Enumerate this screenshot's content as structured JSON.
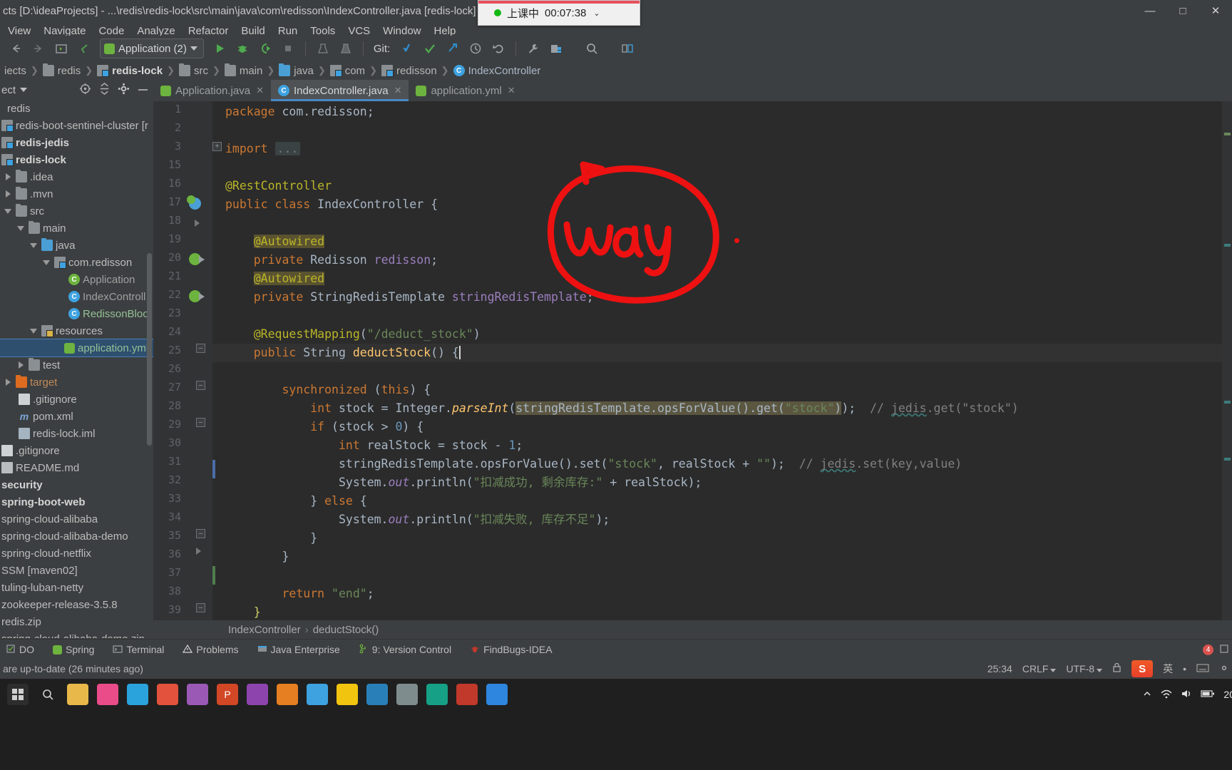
{
  "window": {
    "title": "cts [D:\\ideaProjects] - ...\\redis\\redis-lock\\src\\main\\java\\com\\redisson\\IndexController.java [redis-lock]",
    "minimize": "—",
    "maximize": "□",
    "close": "✕"
  },
  "timer_overlay": {
    "status_text": "上课中",
    "time": "00:07:38",
    "caret": "⌄"
  },
  "menubar": {
    "items": [
      "View",
      "Navigate",
      "Code",
      "Analyze",
      "Refactor",
      "Build",
      "Run",
      "Tools",
      "VCS",
      "Window",
      "Help"
    ]
  },
  "toolbar": {
    "back": "←",
    "forward": "→",
    "run_config_label": "Application (2)",
    "git_label": "Git:",
    "tooltips": {
      "run": "Run",
      "debug": "Debug",
      "run_coverage": "Run with Coverage",
      "stop": "Stop",
      "update_project": "Update Project",
      "commit": "Commit",
      "push": "Push",
      "history": "History",
      "rollback": "Rollback",
      "settings": "Settings",
      "project_structure": "Project Structure",
      "search": "Search Everywhere"
    }
  },
  "breadcrumb": {
    "items": [
      {
        "label": "iects",
        "icon": "folder-icon",
        "bold": false
      },
      {
        "label": "redis",
        "icon": "folder-icon",
        "bold": false
      },
      {
        "label": "redis-lock",
        "icon": "module-icon",
        "bold": true
      },
      {
        "label": "src",
        "icon": "folder-icon",
        "bold": false
      },
      {
        "label": "main",
        "icon": "folder-icon",
        "bold": false
      },
      {
        "label": "java",
        "icon": "source-folder-icon",
        "bold": false
      },
      {
        "label": "com",
        "icon": "package-icon",
        "bold": false
      },
      {
        "label": "redisson",
        "icon": "package-icon",
        "bold": false
      },
      {
        "label": "IndexController",
        "icon": "class-icon",
        "bold": false
      }
    ]
  },
  "project_panel": {
    "title": "ect",
    "caret": "▾",
    "icons": [
      "locate-icon",
      "collapse-all-icon",
      "gear-icon",
      "hide-icon"
    ],
    "tree": [
      {
        "label": "redis",
        "indent": 0,
        "icon": "none",
        "twisty": "none",
        "style": "plain"
      },
      {
        "label": "redis-boot-sentinel-cluster [r",
        "indent": 0,
        "icon": "module-icon",
        "twisty": "none",
        "style": "plain"
      },
      {
        "label": "redis-jedis",
        "indent": 0,
        "icon": "module-icon",
        "twisty": "none",
        "style": "bold"
      },
      {
        "label": "redis-lock",
        "indent": 0,
        "icon": "module-icon",
        "twisty": "none",
        "style": "bold"
      },
      {
        "label": ".idea",
        "indent": 1,
        "icon": "folder-icon",
        "twisty": "right",
        "style": "plain"
      },
      {
        "label": ".mvn",
        "indent": 1,
        "icon": "folder-icon",
        "twisty": "right",
        "style": "plain"
      },
      {
        "label": "src",
        "indent": 1,
        "icon": "folder-icon",
        "twisty": "down",
        "style": "plain"
      },
      {
        "label": "main",
        "indent": 2,
        "icon": "folder-icon",
        "twisty": "down",
        "style": "plain"
      },
      {
        "label": "java",
        "indent": 3,
        "icon": "source-folder-icon",
        "twisty": "down",
        "style": "plain"
      },
      {
        "label": "com.redisson",
        "indent": 4,
        "icon": "package-icon",
        "twisty": "down",
        "style": "plain"
      },
      {
        "label": "Application",
        "indent": 5,
        "icon": "spring-class-icon",
        "twisty": "none",
        "style": "plain"
      },
      {
        "label": "IndexControll",
        "indent": 5,
        "icon": "class-icon",
        "twisty": "none",
        "style": "plain"
      },
      {
        "label": "RedissonBloo",
        "indent": 5,
        "icon": "runnable-class-icon",
        "twisty": "none",
        "style": "green"
      },
      {
        "label": "resources",
        "indent": 3,
        "icon": "resource-folder-icon",
        "twisty": "down",
        "style": "plain"
      },
      {
        "label": "application.yml",
        "indent": 4,
        "icon": "spring-yaml-icon",
        "twisty": "none",
        "style": "selected"
      },
      {
        "label": "test",
        "indent": 2,
        "icon": "folder-icon",
        "twisty": "right",
        "style": "plain"
      },
      {
        "label": "target",
        "indent": 1,
        "icon": "excluded-folder-icon",
        "twisty": "right",
        "style": "plain"
      },
      {
        "label": ".gitignore",
        "indent": 2,
        "icon": "file-icon",
        "twisty": "none",
        "style": "plain"
      },
      {
        "label": "pom.xml",
        "indent": 2,
        "icon": "maven-icon",
        "twisty": "none",
        "style": "plain"
      },
      {
        "label": "redis-lock.iml",
        "indent": 2,
        "icon": "iml-icon",
        "twisty": "none",
        "style": "plain"
      },
      {
        "label": ".gitignore",
        "indent": 0,
        "icon": "file-icon",
        "twisty": "none",
        "style": "plain"
      },
      {
        "label": "README.md",
        "indent": 0,
        "icon": "markdown-icon",
        "twisty": "none",
        "style": "plain"
      },
      {
        "label": "security",
        "indent": 0,
        "icon": "none",
        "twisty": "none",
        "style": "bold"
      },
      {
        "label": "spring-boot-web",
        "indent": 0,
        "icon": "none",
        "twisty": "none",
        "style": "bold"
      },
      {
        "label": "spring-cloud-alibaba",
        "indent": 0,
        "icon": "none",
        "twisty": "none",
        "style": "plain"
      },
      {
        "label": "spring-cloud-alibaba-demo",
        "indent": 0,
        "icon": "none",
        "twisty": "none",
        "style": "plain"
      },
      {
        "label": "spring-cloud-netflix",
        "indent": 0,
        "icon": "none",
        "twisty": "none",
        "style": "plain"
      },
      {
        "label": "SSM [maven02]",
        "indent": 0,
        "icon": "none",
        "twisty": "none",
        "style": "plain"
      },
      {
        "label": "tuling-luban-netty",
        "indent": 0,
        "icon": "none",
        "twisty": "none",
        "style": "plain"
      },
      {
        "label": "zookeeper-release-3.5.8",
        "indent": 0,
        "icon": "none",
        "twisty": "none",
        "style": "plain"
      },
      {
        "label": "redis.zip",
        "indent": 0,
        "icon": "none",
        "twisty": "none",
        "style": "plain"
      },
      {
        "label": "spring-cloud-alibaba-demo.zip",
        "indent": 0,
        "icon": "none",
        "twisty": "none",
        "style": "plain"
      }
    ]
  },
  "editor_tabs": [
    {
      "label": "Application.java",
      "icon": "spring-class-icon",
      "active": false,
      "close": "✕"
    },
    {
      "label": "IndexController.java",
      "icon": "class-icon",
      "active": true,
      "close": "✕"
    },
    {
      "label": "application.yml",
      "icon": "spring-yaml-icon",
      "active": false,
      "close": "✕"
    }
  ],
  "editor": {
    "line_numbers": [
      "1",
      "2",
      "3",
      "15",
      "16",
      "17",
      "18",
      "19",
      "20",
      "21",
      "22",
      "23",
      "24",
      "25",
      "26",
      "27",
      "28",
      "29",
      "30",
      "31",
      "32",
      "33",
      "34",
      "35",
      "36",
      "37",
      "38",
      "39"
    ],
    "code_lines": [
      "package com.redisson;",
      "",
      "import ...",
      "",
      "@RestController",
      "public class IndexController {",
      "",
      "    @Autowired",
      "    private Redisson redisson;",
      "    @Autowired",
      "    private StringRedisTemplate stringRedisTemplate;",
      "",
      "    @RequestMapping(\"/deduct_stock\")",
      "    public String deductStock() {",
      "",
      "        synchronized (this) {",
      "            int stock = Integer.parseInt(stringRedisTemplate.opsForValue().get(\"stock\")); // jedis.get(\"stock\")",
      "            if (stock > 0) {",
      "                int realStock = stock - 1;",
      "                stringRedisTemplate.opsForValue().set(\"stock\", realStock + \"\"); // jedis.set(key,value)",
      "                System.out.println(\"扣减成功, 剩余库存:\" + realStock);",
      "            } else {",
      "                System.out.println(\"扣减失败, 库存不足\");",
      "            }",
      "        }",
      "",
      "        return \"end\";",
      "    }"
    ],
    "breadcrumb": {
      "class": "IndexController",
      "method": "deductStock()",
      "separator": "›"
    }
  },
  "annotation": {
    "text": "way",
    "color": "#ee1111"
  },
  "tool_window_bar": {
    "left_items": [
      {
        "label": "DO",
        "icon": "todo-icon"
      },
      {
        "label": "Spring",
        "icon": "spring-icon"
      },
      {
        "label": "Terminal",
        "icon": "terminal-icon"
      },
      {
        "label": "Problems",
        "icon": "warning-icon"
      },
      {
        "label": "Java Enterprise",
        "icon": "java-ee-icon"
      },
      {
        "label": "9: Version Control",
        "icon": "vcs-icon"
      },
      {
        "label": "FindBugs-IDEA",
        "icon": "findbugs-icon"
      }
    ],
    "right_badge": "4"
  },
  "status_bar": {
    "message": "are up-to-date (26 minutes ago)",
    "caret_position": "25:34",
    "line_separator": "CRLF",
    "encoding": "UTF-8",
    "ime_lang": "英",
    "ime_brand": "S"
  },
  "taskbar": {
    "clock": "20",
    "tray_icons": [
      "chevron-up-icon",
      "network-icon",
      "volume-icon",
      "battery-icon"
    ],
    "apps": [
      "start-icon",
      "search-icon",
      "explorer-icon",
      "idea-icon",
      "pycharm-icon",
      "chrome-icon",
      "app6-icon",
      "powerpoint-icon",
      "app8-icon",
      "firefox-icon",
      "wechat-icon",
      "folder2-icon",
      "stack-icon",
      "notes-icon",
      "qq-icon",
      "pen-icon",
      "edge-icon"
    ]
  }
}
